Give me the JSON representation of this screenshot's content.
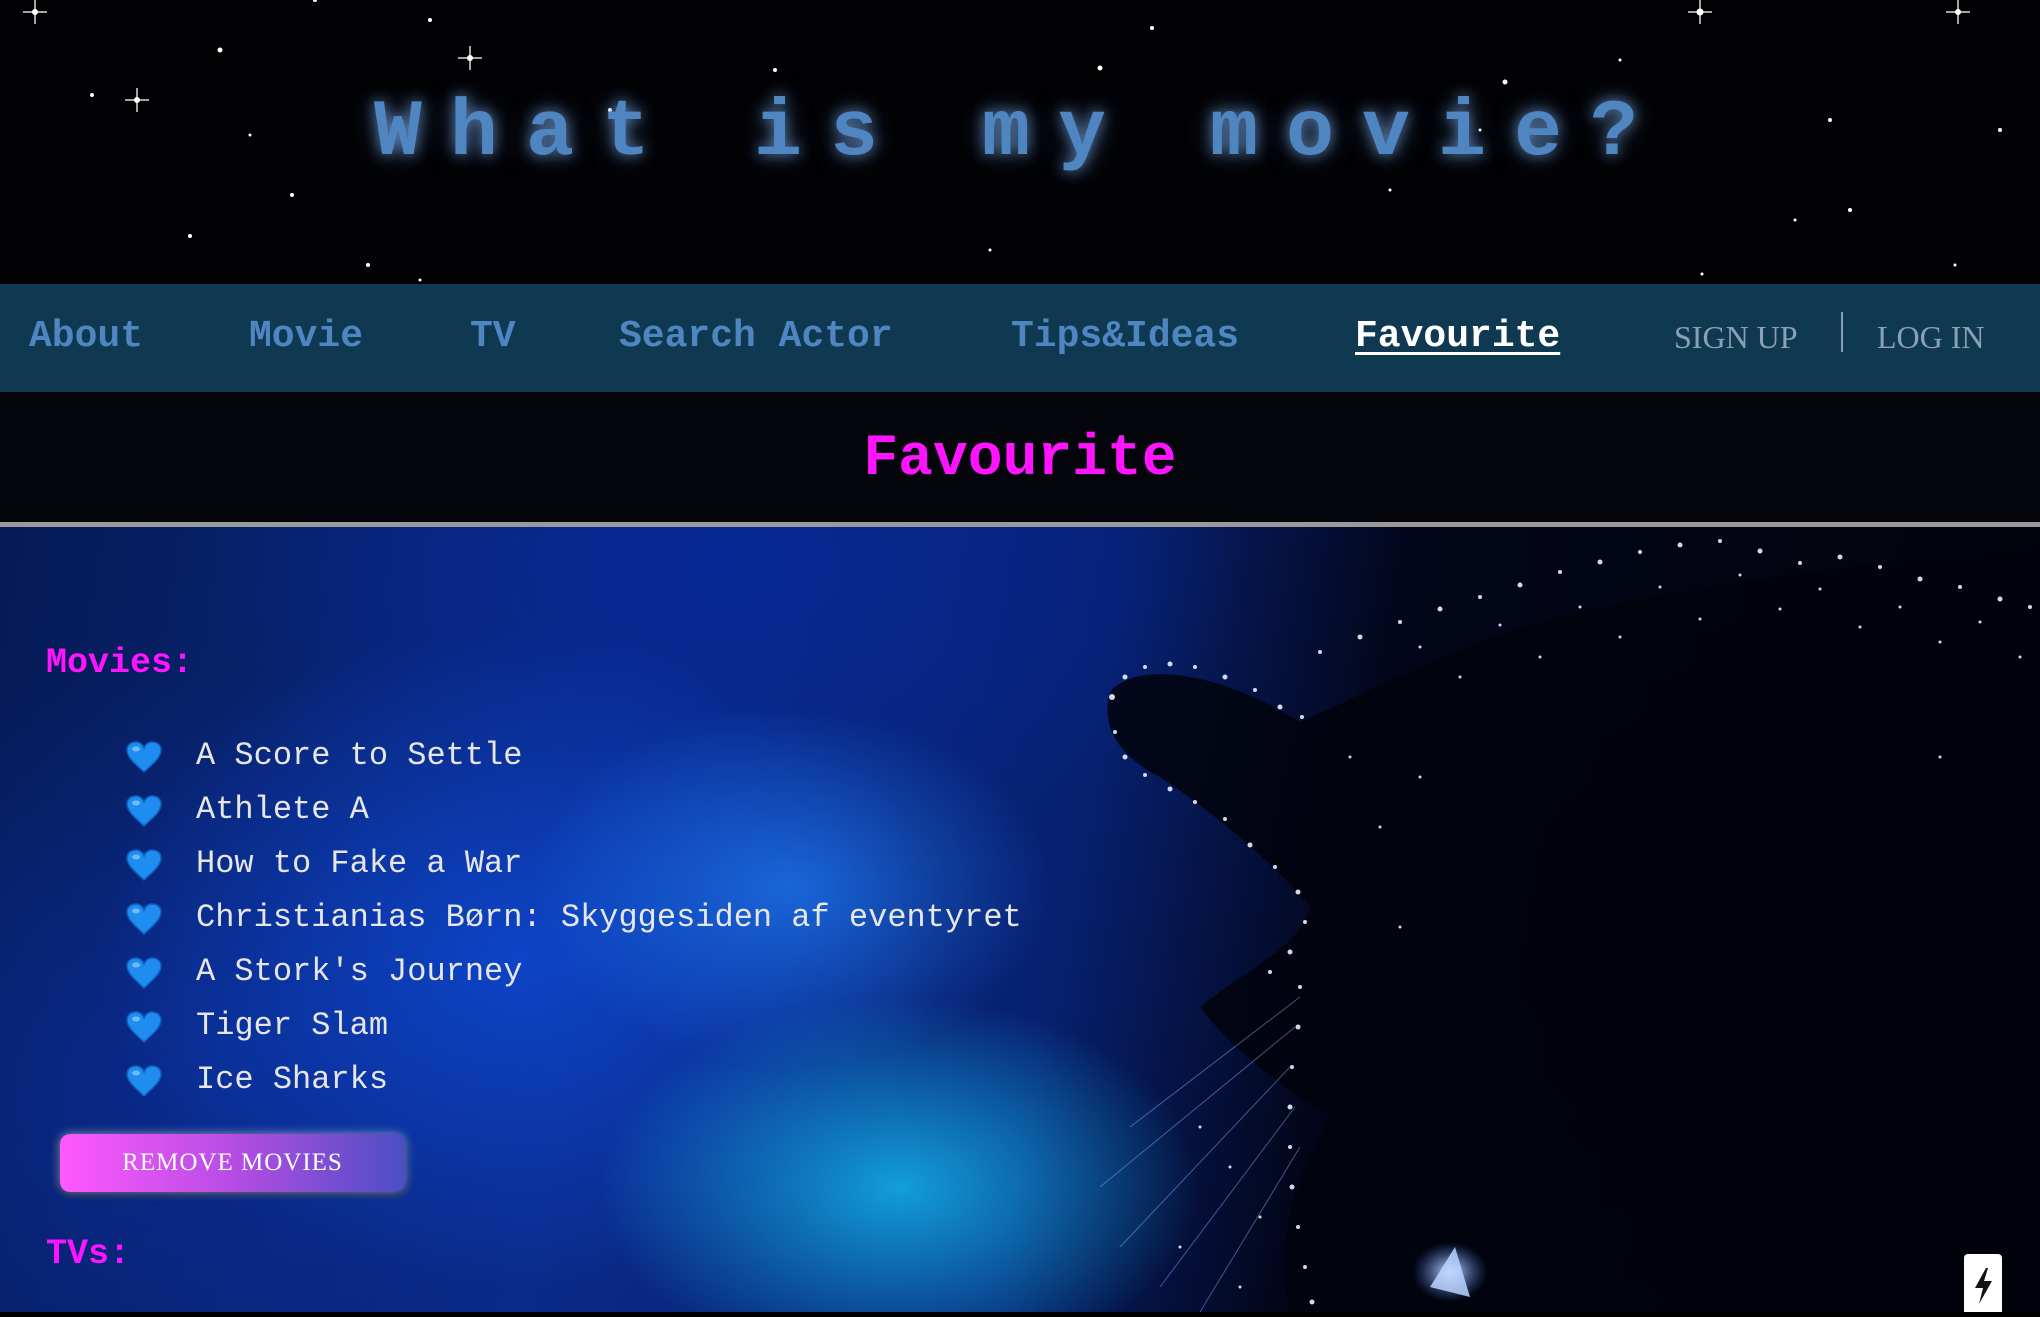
{
  "header": {
    "site_title": "What is my movie?"
  },
  "nav": {
    "items": [
      {
        "label": "About",
        "active": false
      },
      {
        "label": "Movie",
        "active": false
      },
      {
        "label": "TV",
        "active": false
      },
      {
        "label": "Search Actor",
        "active": false
      },
      {
        "label": "Tips&Ideas",
        "active": false
      },
      {
        "label": "Favourite",
        "active": true
      }
    ],
    "sign_up": "SIGN UP",
    "log_in": "LOG IN"
  },
  "page": {
    "heading": "Favourite"
  },
  "favourites": {
    "movies_label": "Movies:",
    "movies": [
      "A Score to Settle",
      "Athlete A",
      "How to Fake a War",
      "Christianias Børn: Skyggesiden af eventyret",
      "A Stork's Journey",
      "Tiger Slam",
      "Ice Sharks"
    ],
    "remove_movies_label": "REMOVE MOVIES",
    "tvs_label": "TVs:"
  },
  "icons": {
    "list_bullet": "blue-heart-icon",
    "corner_badge": "lightning-bolt-icon"
  },
  "colors": {
    "title_blue": "#4f86c2",
    "nav_bg": "#0e3951",
    "accent_magenta": "#ff14ff",
    "heart_blue": "#1f8df0"
  }
}
